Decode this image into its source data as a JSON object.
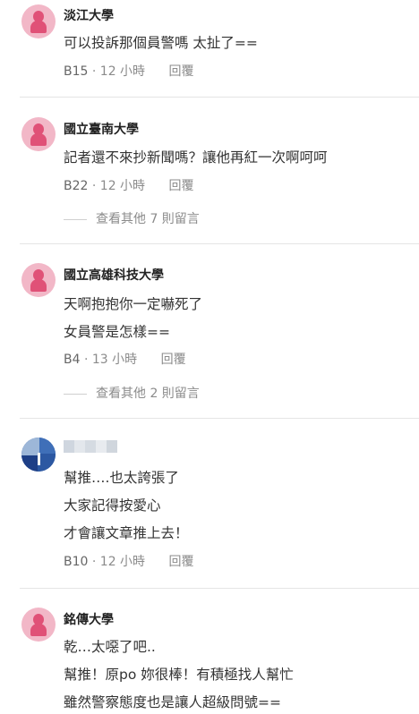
{
  "comments": [
    {
      "school": "淡江大學",
      "lines": [
        "可以投訴那個員警嗎 太扯了=="
      ],
      "floor": "B15",
      "time": "12 小時",
      "reply": "回覆"
    },
    {
      "school": "國立臺南大學",
      "lines": [
        "記者還不來抄新聞嗎？讓他再紅一次啊呵呵"
      ],
      "floor": "B22",
      "time": "12 小時",
      "reply": "回覆",
      "more": "查看其他 7 則留言"
    },
    {
      "school": "國立高雄科技大學",
      "lines": [
        "天啊抱抱你一定嚇死了",
        "女員警是怎樣=="
      ],
      "floor": "B4",
      "time": "13 小時",
      "reply": "回覆",
      "more": "查看其他 2 則留言"
    },
    {
      "school": "",
      "lines": [
        "幫推….也太誇張了",
        "大家記得按愛心",
        "才會讓文章推上去！"
      ],
      "floor": "B10",
      "time": "12 小時",
      "reply": "回覆"
    },
    {
      "school": "銘傳大學",
      "lines": [
        "乾…太噁了吧..",
        "幫推！原po 妳很棒！有積極找人幫忙",
        "雖然警察態度也是讓人超級問號=="
      ]
    }
  ]
}
